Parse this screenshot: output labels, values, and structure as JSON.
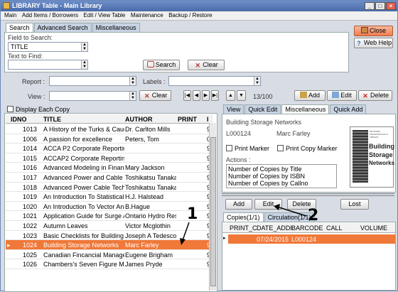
{
  "window": {
    "title": "LIBRARY Table - Main Library"
  },
  "menu": [
    "Main",
    "Add Items / Borrowers",
    "Edit / View Table",
    "Maintenance",
    "Backup / Restore"
  ],
  "search_tabs": [
    "Search",
    "Advanced Search",
    "Miscellaneous"
  ],
  "search": {
    "field_label": "Field to Search:",
    "field_value": "TITLE",
    "find_label": "Text to Find:",
    "find_value": "",
    "search_button": "Search",
    "clear_button": "Clear"
  },
  "side_buttons": {
    "close": "Close",
    "web_help": "Web Help"
  },
  "filters": {
    "report_label": "Report :",
    "labels_label": "Labels :",
    "view_label": "View :",
    "clear_button": "Clear",
    "record_count": "13/100",
    "add_button": "Add",
    "edit_button": "Edit",
    "delete_button": "Delete"
  },
  "display_each_copy": "Display Each Copy",
  "grid": {
    "columns": [
      "IDNO",
      "TITLE",
      "AUTHOR",
      "PRINT",
      "I"
    ],
    "rows": [
      {
        "idno": "1013",
        "title": "A History of the Turks & Cauc",
        "author": "Dr. Carlton Mills",
        "extra": "9"
      },
      {
        "idno": "1006",
        "title": "A passion for excellence",
        "author": "Peters, Tom",
        "extra": "0"
      },
      {
        "idno": "1014",
        "title": "ACCA P2 Corporate Reporting",
        "author": "",
        "extra": "9"
      },
      {
        "idno": "1015",
        "title": "ACCAP2 Corporate Reporting",
        "author": "",
        "extra": "9"
      },
      {
        "idno": "1016",
        "title": "Advanced Modeling in Financ",
        "author": "Mary Jackson",
        "extra": "9"
      },
      {
        "idno": "1017",
        "title": "Advanced Power and Cable T",
        "author": "Toshikatsu Tanaka",
        "extra": "9"
      },
      {
        "idno": "1018",
        "title": "Advanced Power Cable Tech",
        "author": "Toshikatsu Tanaka",
        "extra": "9"
      },
      {
        "idno": "1019",
        "title": "An Introduction To Statistical",
        "author": "H.J. Halstead",
        "extra": "9"
      },
      {
        "idno": "1020",
        "title": "An Introduction To Vector An",
        "author": "B.Hague",
        "extra": "9"
      },
      {
        "idno": "1021",
        "title": "Application Guide for Surge A",
        "author": "Ontario Hydro Res",
        "extra": "9"
      },
      {
        "idno": "1022",
        "title": "Autumn Leaves",
        "author": "Victor Mcglothin",
        "extra": "9"
      },
      {
        "idno": "1023",
        "title": "Basic Checklists for Building E",
        "author": "Joseph A Tedesco",
        "extra": "9"
      },
      {
        "idno": "1024",
        "title": "Building Storage Networks",
        "author": "Marc Farley",
        "extra": "9",
        "selected": true
      },
      {
        "idno": "1025",
        "title": "Canadian Fincancial Managen",
        "author": "Eugene Brigham",
        "extra": "9"
      },
      {
        "idno": "1026",
        "title": "Chambers's Seven Figure M",
        "author": "James Pryde",
        "extra": "9"
      }
    ]
  },
  "detail_tabs": [
    "View",
    "Quick Edit",
    "Miscellaneous",
    "Quick Add"
  ],
  "detail": {
    "title": "Building Storage Networks",
    "idno": "L000124",
    "author": "Marc Farley",
    "print_marker": "Print Marker",
    "print_copy_marker": "Print Copy Marker",
    "actions_label": "Actions :",
    "actions": [
      "Number of Copies by Title",
      "Number of Copies by ISBN",
      "Number of Copies by Callno"
    ],
    "cover_text": [
      "NETWORK PROFESSIONAL'S LIBRARY",
      "Building",
      "Storage",
      "Networks"
    ]
  },
  "copy_buttons": {
    "add": "Add",
    "edit": "Edit",
    "delete": "Delete",
    "lost": "Lost"
  },
  "copy_tabs": [
    "Copies(1/1)",
    "Circulation(1/1)"
  ],
  "copies": {
    "columns": [
      "PRINT_C",
      "DATE_ADDI",
      "BARCODE",
      "CALL",
      "VOLUME"
    ],
    "rows": [
      {
        "date": "07/24/2015",
        "barcode": "L000124"
      }
    ]
  },
  "callouts": [
    "1",
    "2"
  ],
  "colors": {
    "selection": "#f07838",
    "accent_blue": "#4a6aa8"
  }
}
